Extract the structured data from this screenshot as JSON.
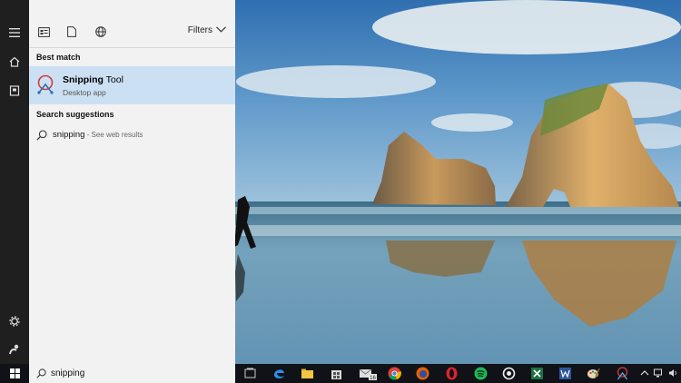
{
  "rail": {
    "icons": [
      "hamburger-icon",
      "home-icon",
      "notebook-icon",
      "settings-icon",
      "feedback-icon"
    ]
  },
  "panel": {
    "toolbar": {
      "icons": [
        "apps-icon",
        "documents-icon",
        "web-icon"
      ],
      "filters_label": "Filters"
    },
    "best_match": {
      "heading": "Best match",
      "app_name_bold": "Snipping",
      "app_name_rest": " Tool",
      "app_type": "Desktop app"
    },
    "suggestions": {
      "heading": "Search suggestions",
      "items": [
        {
          "query": "snipping",
          "hint": " - See web results"
        }
      ]
    }
  },
  "search": {
    "value": "snipping"
  },
  "taskbar": {
    "apps": [
      "task-view-icon",
      "edge-icon",
      "file-explorer-icon",
      "store-icon",
      "mail-icon",
      "chrome-icon",
      "firefox-icon",
      "opera-icon",
      "spotify-icon",
      "steam-icon",
      "excel-icon",
      "word-icon",
      "paint-icon",
      "snipping-tool-icon"
    ],
    "mail_badge": "16"
  },
  "colors": {
    "accent_selection": "#cce0f4",
    "panel_bg": "#f2f2f2",
    "rail_bg": "#1f1f1f",
    "taskbar_bg": "#101218"
  }
}
